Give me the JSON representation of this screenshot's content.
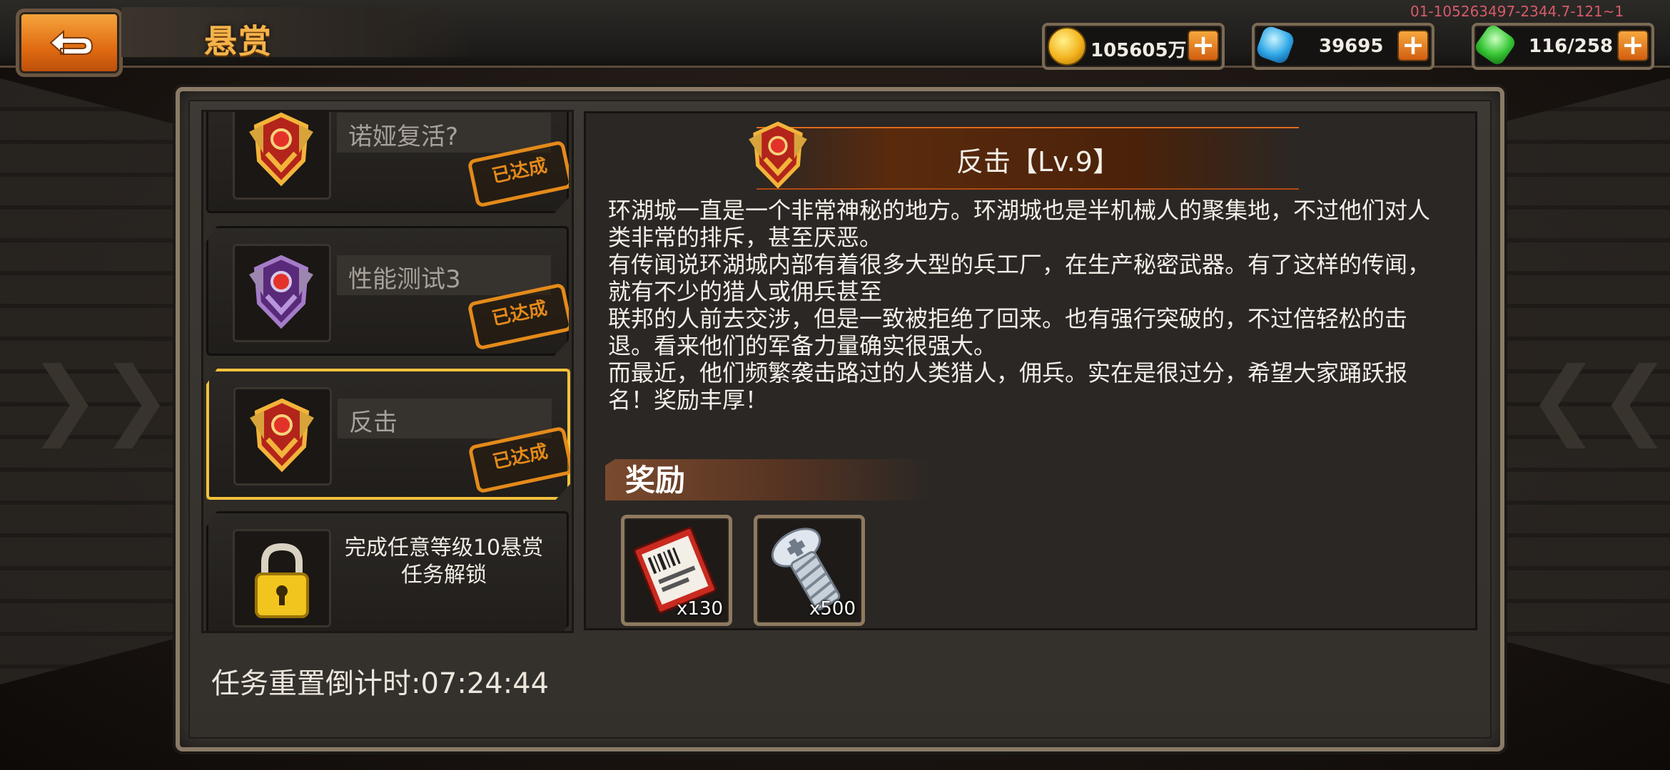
{
  "header": {
    "title": "悬赏",
    "debug_id": "01-105263497-2344.7-121~1"
  },
  "resources": [
    {
      "name": "gold",
      "value": "105605万",
      "color": "#f3b31d",
      "icon": "gold-coin-icon"
    },
    {
      "name": "crystal",
      "value": "39695",
      "color": "#2fa7e6",
      "icon": "blue-crystal-icon"
    },
    {
      "name": "stamina",
      "value": "116/258",
      "color": "#36c534",
      "icon": "green-gem-icon"
    }
  ],
  "task_list": [
    {
      "name": "诺娅复活?",
      "status": "已达成",
      "badge_color": "red",
      "selected": false
    },
    {
      "name": "性能测试3",
      "status": "已达成",
      "badge_color": "purple",
      "selected": false
    },
    {
      "name": "反击",
      "status": "已达成",
      "badge_color": "red",
      "selected": true
    },
    {
      "locked": true,
      "lock_text_line1": "完成任意等级10悬赏",
      "lock_text_line2": "任务解锁"
    }
  ],
  "countdown": "任务重置倒计时:07:24:44",
  "detail": {
    "title": "反击【Lv.9】",
    "description": [
      "环湖城一直是一个非常神秘的地方。环湖城也是半机械人的聚集地，不过他们对人类非常的排斥，甚至厌恶。",
      "有传闻说环湖城内部有着很多大型的兵工厂，在生产秘密武器。有了这样的传闻，就有不少的猎人或佣兵甚至",
      "联邦的人前去交涉，但是一致被拒绝了回来。也有强行突破的，不过倍轻松的击退。看来他们的军备力量确实很强大。",
      "而最近，他们频繁袭击路过的人类猎人，佣兵。实在是很过分，希望大家踊跃报名！奖励丰厚！"
    ],
    "reward_title": "奖励",
    "rewards": [
      {
        "icon": "ticket-icon",
        "count": "x130"
      },
      {
        "icon": "bolt-screw-icon",
        "count": "x500"
      }
    ]
  }
}
